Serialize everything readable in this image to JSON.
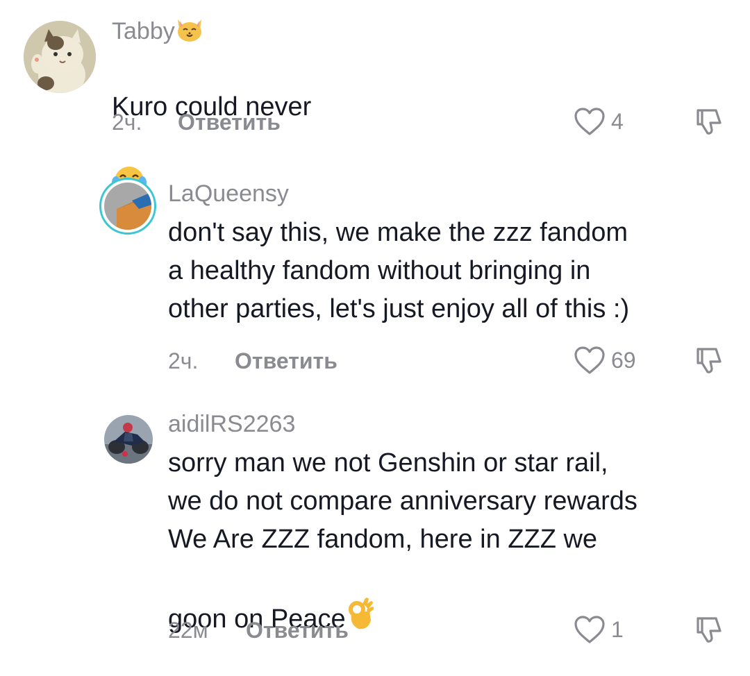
{
  "comments": [
    {
      "username": "Tabby",
      "username_emoji": "cat-face-emoji",
      "text": "Kuro could never",
      "text_emoji": "tears-of-joy-emoji",
      "time": "2ч.",
      "reply_label": "Ответить",
      "likes": "4"
    },
    {
      "username": "LaQueensy",
      "text": "don't say this, we make the zzz fandom\na healthy fandom without bringing in\nother parties, let's just enjoy all of this :)",
      "time": "2ч.",
      "reply_label": "Ответить",
      "likes": "69"
    },
    {
      "username": "aidilRS2263",
      "text": "sorry man we not Genshin or star rail,\nwe do not compare anniversary rewards\nWe Are ZZZ fandom, here in ZZZ we\ngoon on Peace",
      "text_emoji": "ok-hand-emoji",
      "time": "22м",
      "reply_label": "Ответить",
      "likes": "1"
    }
  ],
  "colors": {
    "text": "#161823",
    "muted": "#8a8b91",
    "ring": "#3cc6d2"
  }
}
